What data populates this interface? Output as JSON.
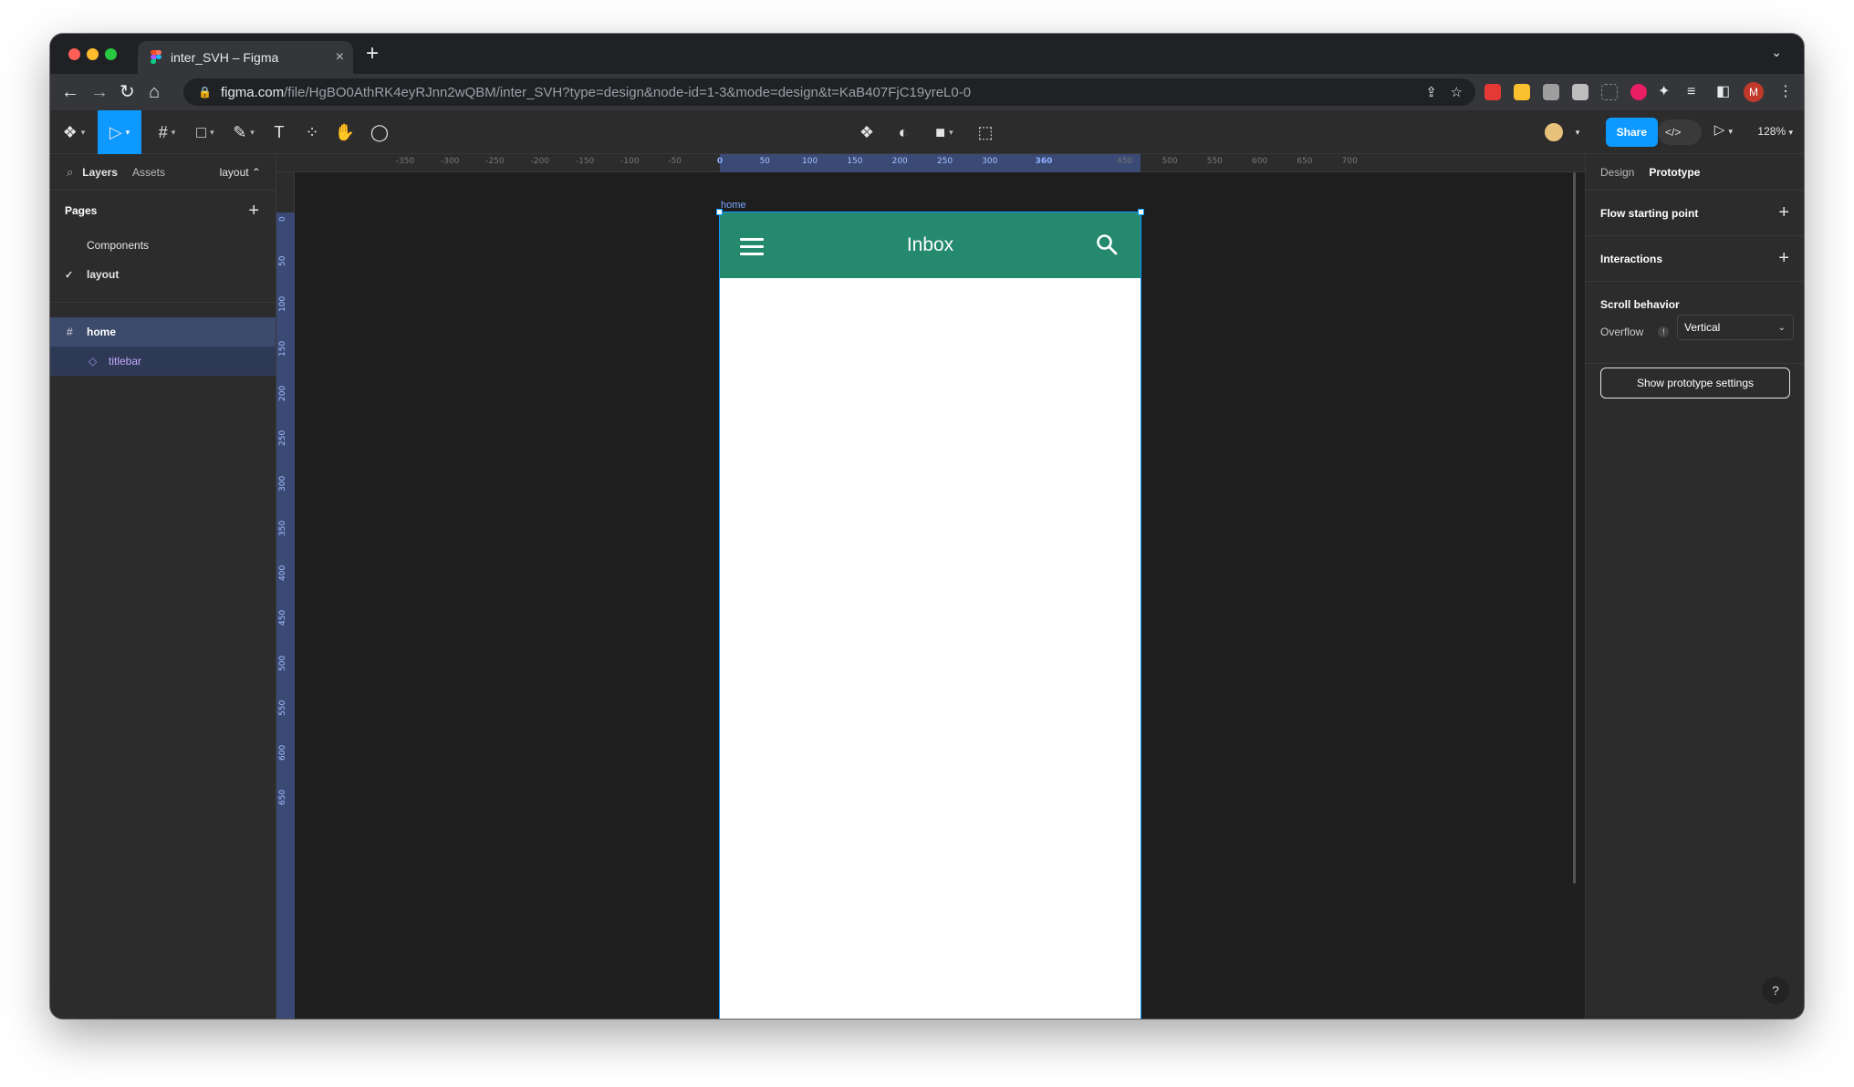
{
  "browser": {
    "tab_title": "inter_SVH – Figma",
    "tab_close": "×",
    "new_tab": "+",
    "tabs_menu": "⌄",
    "url_host": "figma.com",
    "url_path": "/file/HgBO0AthRK4eyRJnn2wQBM/inter_SVH?type=design&node-id=1-3&mode=design&t=KaB407FjC19yreL0-0",
    "profile_initial": "M"
  },
  "figma_toolbar": {
    "share_label": "Share",
    "dev_label": "</>",
    "zoom": "128%"
  },
  "left_panel": {
    "tabs": {
      "layers": "Layers",
      "assets": "Assets",
      "page_selector": "layout ⌃"
    },
    "pages_heading": "Pages",
    "pages": [
      "Components",
      "layout"
    ],
    "layers": [
      {
        "label": "home",
        "icon": "frame-icon"
      },
      {
        "label": "titlebar",
        "icon": "component-instance-icon"
      }
    ]
  },
  "canvas": {
    "ruler_x_ticks": [
      "-350",
      "-300",
      "-250",
      "-200",
      "-150",
      "-100",
      "-50",
      "0",
      "50",
      "100",
      "150",
      "200",
      "250",
      "300",
      "360",
      "450",
      "500",
      "550",
      "600",
      "650",
      "700"
    ],
    "ruler_y_ticks": [
      "0",
      "50",
      "100",
      "150",
      "200",
      "250",
      "300",
      "350",
      "400",
      "450",
      "500",
      "550",
      "600",
      "650"
    ],
    "frame_label": "home",
    "app_title": "Inbox",
    "titlebar_color": "#24896d"
  },
  "right_panel": {
    "tabs": {
      "design": "Design",
      "prototype": "Prototype"
    },
    "flow_start": "Flow starting point",
    "interactions": "Interactions",
    "scroll_behavior": "Scroll behavior",
    "overflow_label": "Overflow",
    "overflow_value": "Vertical",
    "prototype_settings_button": "Show prototype settings",
    "help": "?"
  },
  "colors": {
    "accent": "#0d99ff",
    "canvas_bg": "#1e1e1e",
    "panel_bg": "#2c2c2c"
  }
}
